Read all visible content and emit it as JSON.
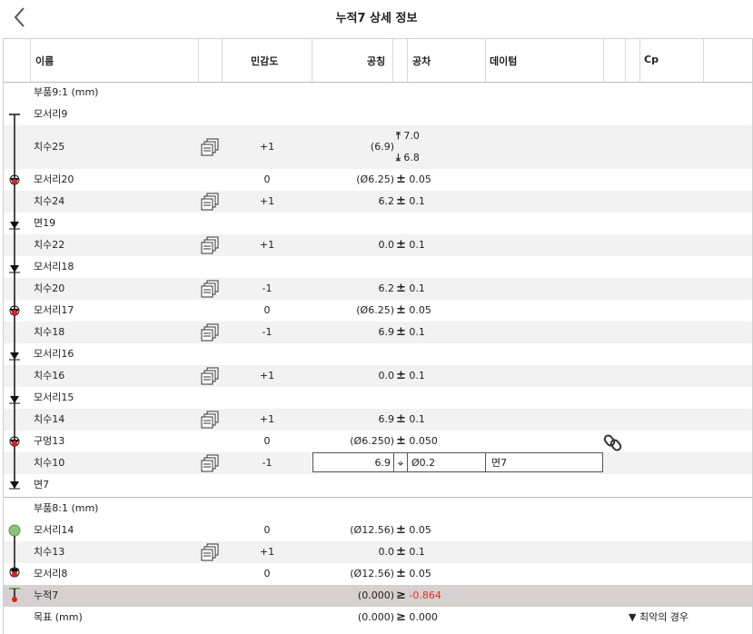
{
  "header": {
    "back_label": "<",
    "title": "누적7 상세 정보"
  },
  "columns": {
    "name": "이름",
    "sensitivity": "민감도",
    "nominal": "공칭",
    "tolerance": "공차",
    "datum": "데이텀",
    "cp": "Cp"
  },
  "part9": {
    "label": "부품9:1 (mm)"
  },
  "part8": {
    "label": "부품8:1 (mm)"
  },
  "rows": [
    {
      "name": "모서리9"
    },
    {
      "name": "치수25",
      "sens": "+1",
      "nom": "(6.9)",
      "upper": "7.0",
      "lower": "6.8"
    },
    {
      "name": "모서리20",
      "sens": "0",
      "nom": "(Ø6.25)",
      "tol": "0.05"
    },
    {
      "name": "치수24",
      "sens": "+1",
      "nom": "6.2",
      "tol": "0.1"
    },
    {
      "name": "면19"
    },
    {
      "name": "치수22",
      "sens": "+1",
      "nom": "0.0",
      "tol": "0.1"
    },
    {
      "name": "모서리18"
    },
    {
      "name": "치수20",
      "sens": "-1",
      "nom": "6.2",
      "tol": "0.1"
    },
    {
      "name": "모서리17",
      "sens": "0",
      "nom": "(Ø6.25)",
      "tol": "0.05"
    },
    {
      "name": "치수18",
      "sens": "-1",
      "nom": "6.9",
      "tol": "0.1"
    },
    {
      "name": "모서리16"
    },
    {
      "name": "치수16",
      "sens": "+1",
      "nom": "0.0",
      "tol": "0.1"
    },
    {
      "name": "모서리15"
    },
    {
      "name": "치수14",
      "sens": "+1",
      "nom": "6.9",
      "tol": "0.1"
    },
    {
      "name": "구멍13",
      "sens": "0",
      "nom": "(Ø6.250)",
      "tol": "0.050"
    },
    {
      "name": "치수10",
      "sens": "-1",
      "nom": "6.9",
      "tol": "Ø0.2",
      "datum": "면7"
    },
    {
      "name": "면7"
    },
    {
      "name": "모서리14",
      "sens": "0",
      "nom": "(Ø12.56)",
      "tol": "0.05"
    },
    {
      "name": "치수13",
      "sens": "+1",
      "nom": "0.0",
      "tol": "0.1"
    },
    {
      "name": "모서리8",
      "sens": "0",
      "nom": "(Ø12.56)",
      "tol": "0.05"
    },
    {
      "name": "누적7",
      "nom": "(0.000)",
      "cmp": "≥",
      "result": "-0.864"
    },
    {
      "name": "목표 (mm)",
      "nom": "(0.000)",
      "cmp": "≥",
      "result": "0.000",
      "worst": "▼ 최악의 경우"
    }
  ],
  "colors": {
    "negative": "#e0301e",
    "selected_row": "#d6d0d0",
    "alt_row": "#f2f2f2",
    "marker_red": "#e02020",
    "marker_green": "#5a9a3a"
  },
  "icons": {
    "back": "chevron-left-icon",
    "copy": "copy-pages-icon",
    "link": "chain-link-icon",
    "position": "position-target-icon"
  }
}
